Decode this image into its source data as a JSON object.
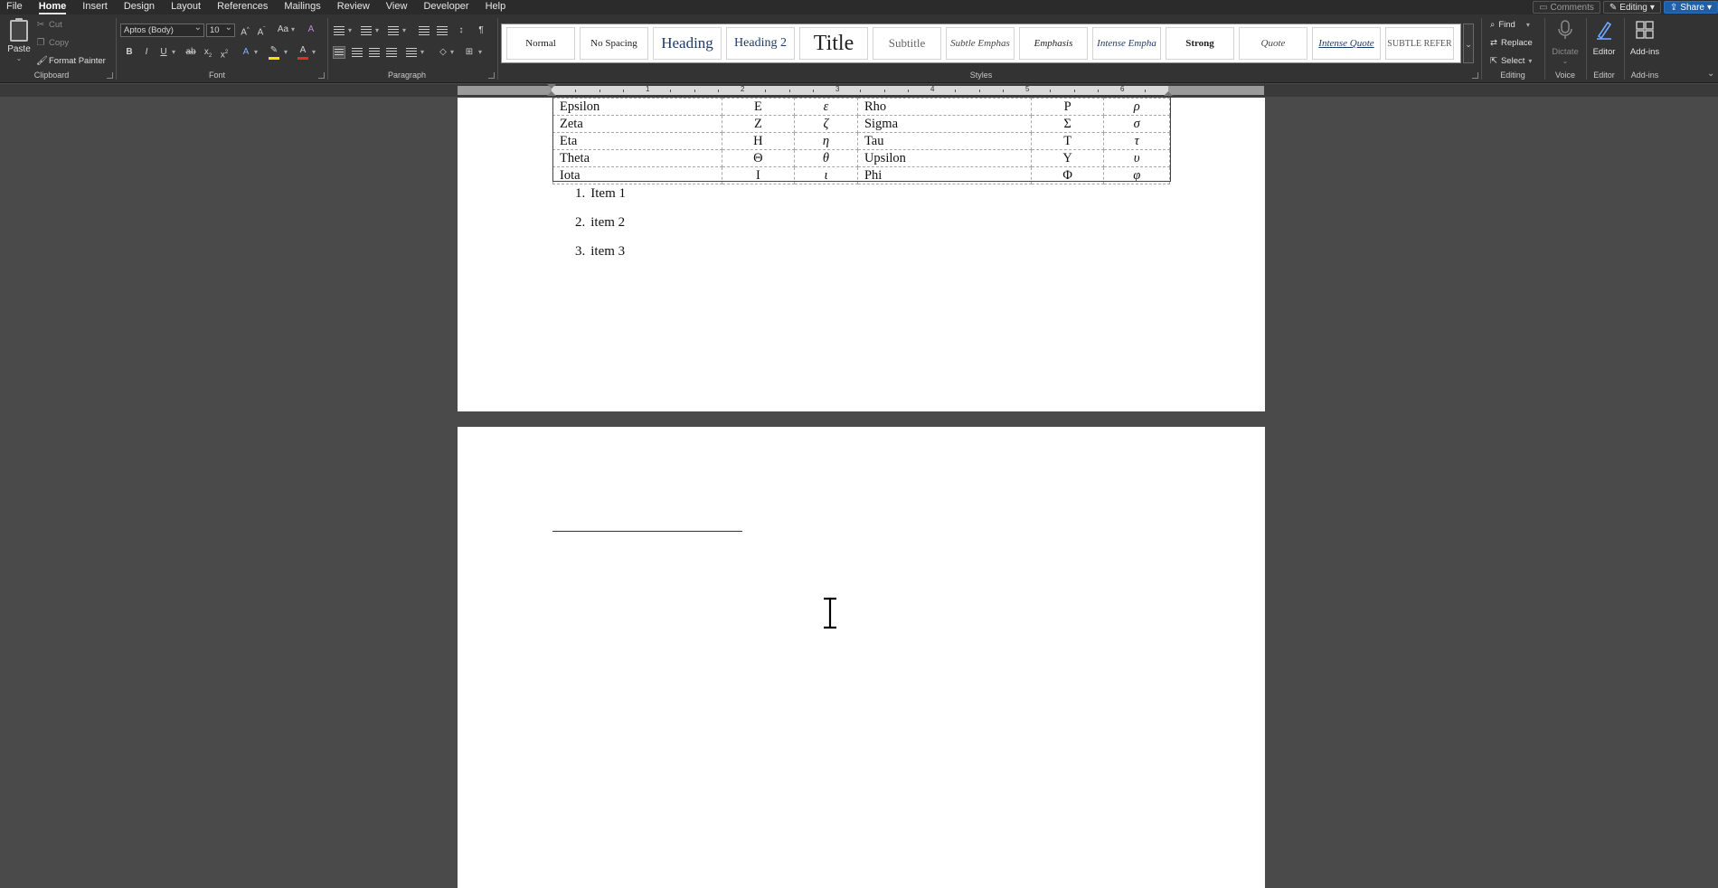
{
  "menubar": {
    "tabs": [
      "File",
      "Home",
      "Insert",
      "Design",
      "Layout",
      "References",
      "Mailings",
      "Review",
      "View",
      "Developer",
      "Help"
    ],
    "active_tab": "Home",
    "comments_label": "Comments",
    "editing_label": "Editing",
    "share_label": "Share"
  },
  "ribbon": {
    "clipboard": {
      "paste": "Paste",
      "cut": "Cut",
      "copy": "Copy",
      "format_painter": "Format Painter",
      "label": "Clipboard"
    },
    "font": {
      "font_name": "Aptos (Body)",
      "font_size": "10",
      "label": "Font"
    },
    "paragraph": {
      "label": "Paragraph"
    },
    "styles": {
      "label": "Styles",
      "items": [
        "Normal",
        "No Spacing",
        "Heading",
        "Heading 2",
        "Title",
        "Subtitle",
        "Subtle Emphas",
        "Emphasis",
        "Intense Empha",
        "Strong",
        "Quote",
        "Intense Quote",
        "SUBTLE REFER"
      ]
    },
    "editing": {
      "find": "Find",
      "replace": "Replace",
      "select": "Select",
      "label": "Editing"
    },
    "voice": {
      "dictate": "Dictate",
      "label": "Voice"
    },
    "editor": {
      "button": "Editor",
      "label": "Editor"
    },
    "addins": {
      "button": "Add-ins",
      "label": "Add-ins"
    }
  },
  "ruler": {
    "numbers": [
      "1",
      "2",
      "3",
      "4",
      "5",
      "6"
    ]
  },
  "document": {
    "table_rows": [
      [
        "Epsilon",
        "Ε",
        "ε",
        "Rho",
        "Ρ",
        "ρ"
      ],
      [
        "Zeta",
        "Ζ",
        "ζ",
        "Sigma",
        "Σ",
        "σ"
      ],
      [
        "Eta",
        "Η",
        "η",
        "Tau",
        "Τ",
        "τ"
      ],
      [
        "Theta",
        "Θ",
        "θ",
        "Upsilon",
        "Υ",
        "υ"
      ],
      [
        "Iota",
        "Ι",
        "ι",
        "Phi",
        "Φ",
        "φ"
      ]
    ],
    "list": [
      {
        "num": "1.",
        "text": "Item 1"
      },
      {
        "num": "2.",
        "text": "item 2"
      },
      {
        "num": "3.",
        "text": "item 3"
      }
    ]
  },
  "colors": {
    "share_blue": "#1f5fa8",
    "highlight_yellow": "#f2e600",
    "font_color_red": "#e03020",
    "page": "#ffffff",
    "canvas": "#4a4a4a"
  }
}
